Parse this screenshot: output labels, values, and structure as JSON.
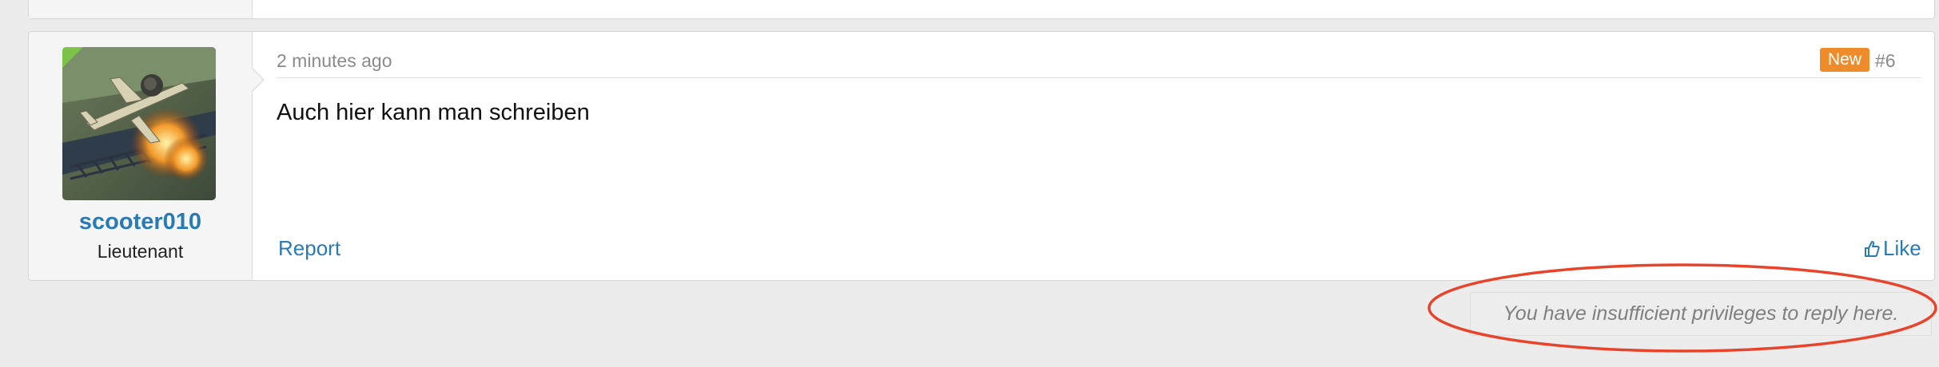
{
  "post": {
    "author": {
      "username": "scooter010",
      "title": "Lieutenant",
      "avatar": "avatar-image",
      "online": true
    },
    "timestamp": "2 minutes ago",
    "badge": "New",
    "number": "#6",
    "message": "Auch hier kann man schreiben",
    "report_label": "Report",
    "like_label": "Like"
  },
  "reply_notice": "You have insufficient privileges to reply here.",
  "colors": {
    "link": "#2a7ab4",
    "badge_bg": "#ee8c2c",
    "online": "#7cc34a",
    "annotation": "#e8442c"
  },
  "icons": {
    "like": "thumbs-up-icon"
  }
}
